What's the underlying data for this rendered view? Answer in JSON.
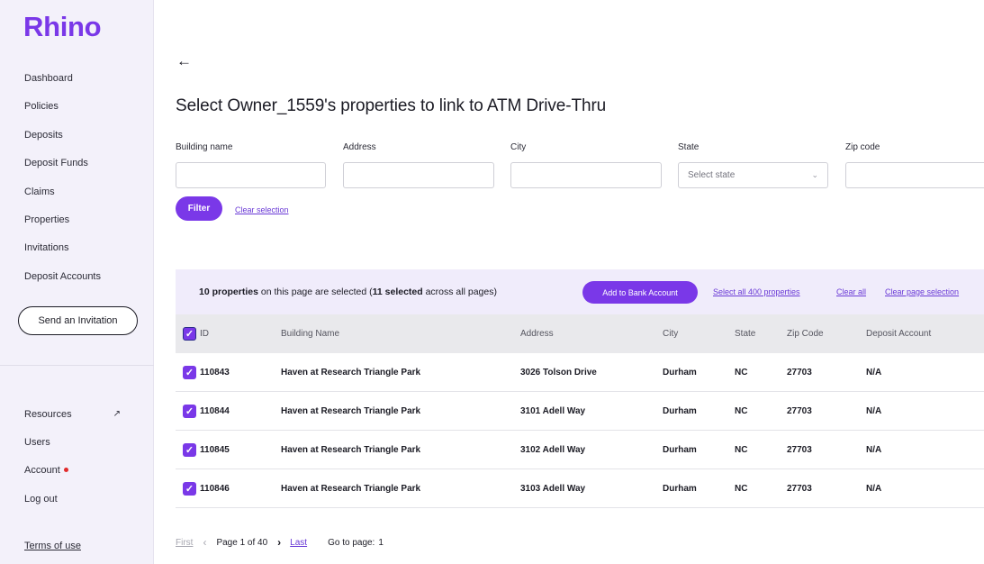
{
  "sidebar": {
    "logo": "Rhino",
    "nav": [
      "Dashboard",
      "Policies",
      "Deposits",
      "Deposit Funds",
      "Claims",
      "Properties",
      "Invitations",
      "Deposit Accounts"
    ],
    "invite_button": "Send an Invitation",
    "secondary_nav": [
      "Resources",
      "Users",
      "Account",
      "Log out"
    ],
    "resources_icon": "external-link-icon",
    "account_badge_color": "#e12b2b",
    "terms": "Terms of use"
  },
  "header": {
    "back_icon": "arrow-left-icon",
    "back_glyph": "←",
    "title": "Select Owner_1559's properties to link to ATM Drive-Thru"
  },
  "filters": {
    "building_name": {
      "label": "Building name",
      "value": ""
    },
    "address": {
      "label": "Address",
      "value": ""
    },
    "city": {
      "label": "City",
      "value": ""
    },
    "state": {
      "label": "State",
      "placeholder": "Select state"
    },
    "zip": {
      "label": "Zip code",
      "value": ""
    },
    "filter_button": "Filter",
    "clear_selection": "Clear selection"
  },
  "banner": {
    "count_bold": "10 properties",
    "text_1": " on this page are selected (",
    "total_bold": "11 selected",
    "text_2": " across all pages)",
    "add_button": "Add to Bank Account",
    "select_all": "Select all 400 properties",
    "clear_all": "Clear all",
    "clear_page": "Clear page selection"
  },
  "table": {
    "headers": [
      "ID",
      "Building Name",
      "Address",
      "City",
      "State",
      "Zip Code",
      "Deposit Account"
    ],
    "rows": [
      [
        "110843",
        "Haven at Research Triangle Park",
        "3026 Tolson Drive",
        "Durham",
        "NC",
        "27703",
        "N/A"
      ],
      [
        "110844",
        "Haven at Research Triangle Park",
        "3101 Adell Way",
        "Durham",
        "NC",
        "27703",
        "N/A"
      ],
      [
        "110845",
        "Haven at Research Triangle Park",
        "3102 Adell Way",
        "Durham",
        "NC",
        "27703",
        "N/A"
      ],
      [
        "110846",
        "Haven at Research Triangle Park",
        "3103 Adell Way",
        "Durham",
        "NC",
        "27703",
        "N/A"
      ]
    ]
  },
  "pagination": {
    "first": "First",
    "info": "Page 1 of 40",
    "last": "Last",
    "goto_label": "Go to page:",
    "goto_value": "1"
  },
  "colors": {
    "accent": "#7a38e8",
    "banner": "#f0ecfb",
    "sidebar": "#f3f1fa"
  }
}
